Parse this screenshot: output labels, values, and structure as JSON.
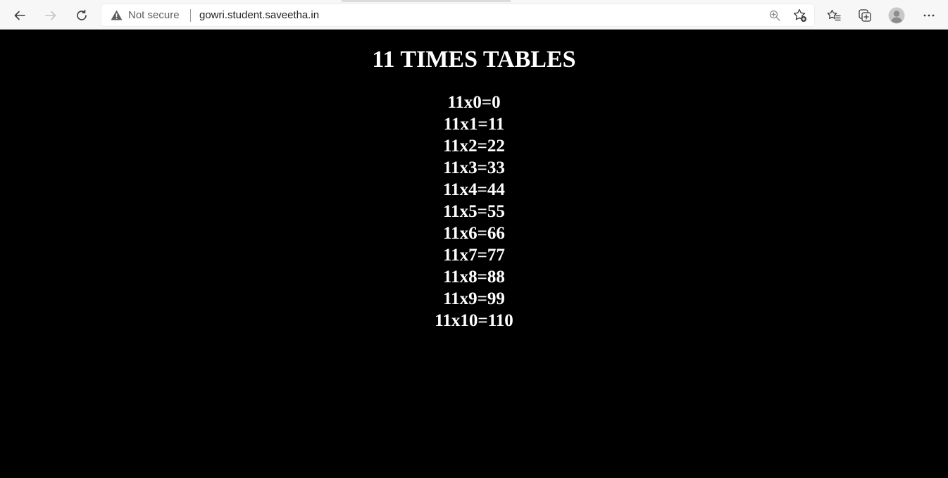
{
  "browser": {
    "security_label": "Not secure",
    "url": "gowri.student.saveetha.in",
    "icons": {
      "back": "back-arrow-icon",
      "forward": "forward-arrow-icon",
      "reload": "reload-icon",
      "warning": "warning-icon",
      "zoom": "zoom-icon",
      "add_favorite": "add-favorite-icon",
      "favorites": "favorites-icon",
      "collections": "collections-icon",
      "profile": "profile-icon",
      "menu": "more-menu-icon"
    }
  },
  "page": {
    "title": "11 TIMES TABLES",
    "rows": [
      "11x0=0",
      "11x1=11",
      "11x2=22",
      "11x3=33",
      "11x4=44",
      "11x5=55",
      "11x6=66",
      "11x7=77",
      "11x8=88",
      "11x9=99",
      "11x10=110"
    ],
    "colors": {
      "background": "#000000",
      "text": "#ffffff"
    }
  }
}
